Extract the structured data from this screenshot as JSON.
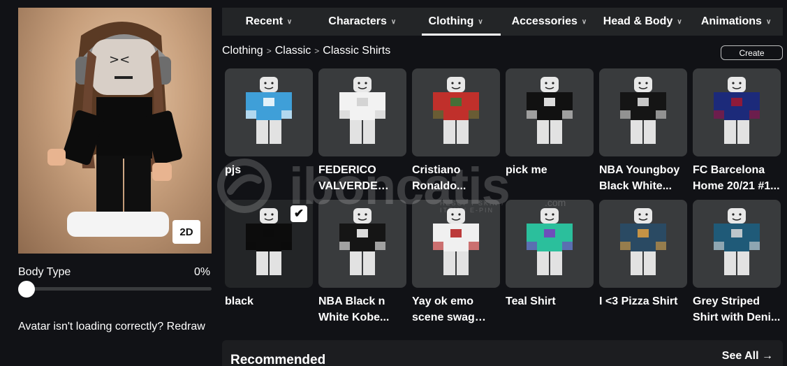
{
  "avatar": {
    "view_toggle": "2D",
    "body_type_label": "Body Type",
    "body_type_value": "0%",
    "body_type_fraction": 0,
    "help_text": "Avatar isn't loading correctly?",
    "redraw_label": "Redraw"
  },
  "tabs": [
    {
      "label": "Recent",
      "active": false
    },
    {
      "label": "Characters",
      "active": false
    },
    {
      "label": "Clothing",
      "active": true
    },
    {
      "label": "Accessories",
      "active": false
    },
    {
      "label": "Head & Body",
      "active": false
    },
    {
      "label": "Animations",
      "active": false
    }
  ],
  "breadcrumb": [
    "Clothing",
    "Classic",
    "Classic Shirts"
  ],
  "create_label": "Create",
  "items": [
    {
      "name": "pjs",
      "shirt_color": "#3f9fd8",
      "accent_color": "#ffffff",
      "selected": false
    },
    {
      "name": "FEDERICO VALVERDE REA...",
      "shirt_color": "#f2f2f2",
      "accent_color": "#cfcfcf",
      "selected": false
    },
    {
      "name": "Cristiano Ronaldo...",
      "shirt_color": "#c0302b",
      "accent_color": "#2f7a3a",
      "selected": false
    },
    {
      "name": "pick me",
      "shirt_color": "#111111",
      "accent_color": "#ffffff",
      "selected": false
    },
    {
      "name": "NBA Youngboy Black White...",
      "shirt_color": "#151515",
      "accent_color": "#e6e6e6",
      "selected": false
    },
    {
      "name": "FC Barcelona Home 20/21 #1...",
      "shirt_color": "#1c2a7a",
      "accent_color": "#a2172e",
      "selected": false
    },
    {
      "name": "black",
      "shirt_color": "#0c0c0c",
      "accent_color": "#0c0c0c",
      "selected": true
    },
    {
      "name": "NBA Black n White Kobe...",
      "shirt_color": "#151515",
      "accent_color": "#ffffff",
      "selected": false
    },
    {
      "name": "Yay ok emo scene swag dh...",
      "shirt_color": "#f0f0f0",
      "accent_color": "#b31b1b",
      "selected": false
    },
    {
      "name": "Teal Shirt",
      "shirt_color": "#2bbf9c",
      "accent_color": "#7a3bbf",
      "selected": false
    },
    {
      "name": "I <3 Pizza Shirt",
      "shirt_color": "#2a4a63",
      "accent_color": "#e0a040",
      "selected": false
    },
    {
      "name": "Grey Striped Shirt with Deni...",
      "shirt_color": "#1f5a78",
      "accent_color": "#d9d9d9",
      "selected": false
    }
  ],
  "recommended": {
    "title": "Recommended",
    "see_all": "See All"
  },
  "watermark": {
    "text": "iboncatis",
    "subtext": "HESOP / SKIN / ITEM / E-PIN",
    "suffix": ".com"
  },
  "colors": {
    "page_bg": "#111216",
    "tab_bar_bg": "#232527",
    "card_bg": "#393b3d"
  }
}
